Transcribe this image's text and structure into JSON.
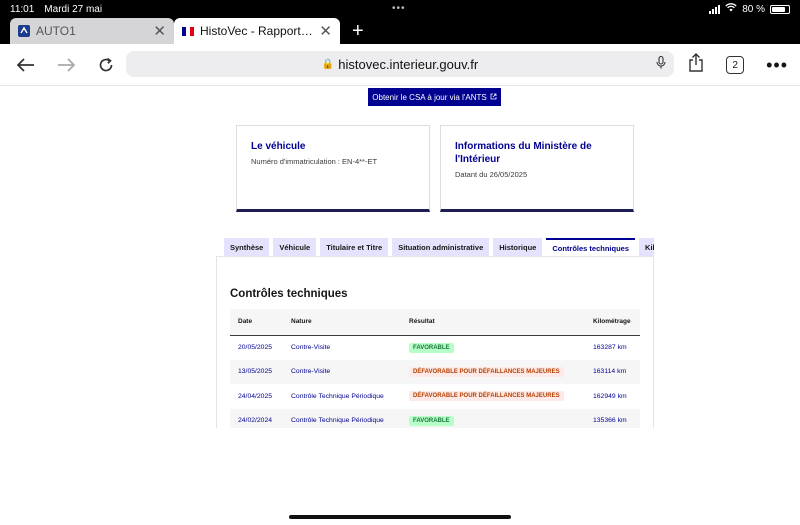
{
  "status": {
    "time": "11:01",
    "date": "Mardi 27 mai",
    "battery": "80 %"
  },
  "browser": {
    "tabs": [
      {
        "label": "AUTO1",
        "active": false
      },
      {
        "label": "HistoVec - Rapport vendeur",
        "active": true
      }
    ],
    "url": "histovec.interieur.gouv.fr",
    "tab_count": "2"
  },
  "page": {
    "ants_button": "Obtenir le CSA à jour via l'ANTS",
    "vehicle_card": {
      "title": "Le véhicule",
      "text": "Numéro d'immatriculation : EN-4**-ET"
    },
    "ministry_card": {
      "title": "Informations du Ministère de l'Intérieur",
      "text": "Datant du 26/05/2025"
    },
    "tabs": [
      {
        "label": "Synthèse"
      },
      {
        "label": "Véhicule"
      },
      {
        "label": "Titulaire et Titre"
      },
      {
        "label": "Situation administrative"
      },
      {
        "label": "Historique"
      },
      {
        "label": "Contrôles techniques"
      },
      {
        "label": "Kilométrage"
      }
    ],
    "section_title": "Contrôles techniques",
    "table": {
      "headers": [
        "Date",
        "Nature",
        "Résultat",
        "Kilométrage"
      ],
      "rows": [
        {
          "date": "20/05/2025",
          "nature": "Contre-Visite",
          "result": "FAVORABLE",
          "km": "163287 km"
        },
        {
          "date": "13/05/2025",
          "nature": "Contre-Visite",
          "result": "DÉFAVORABLE POUR DÉFAILLANCES MAJEURES",
          "km": "163114 km"
        },
        {
          "date": "24/04/2025",
          "nature": "Contrôle Technique Périodique",
          "result": "DÉFAVORABLE POUR DÉFAILLANCES MAJEURES",
          "km": "162949 km"
        },
        {
          "date": "24/02/2024",
          "nature": "Contrôle Technique Périodique",
          "result": "FAVORABLE",
          "km": "135366 km"
        }
      ]
    }
  },
  "colors": {
    "primary": "#000091",
    "favorable": "#18753c",
    "defavorable": "#b34000"
  }
}
